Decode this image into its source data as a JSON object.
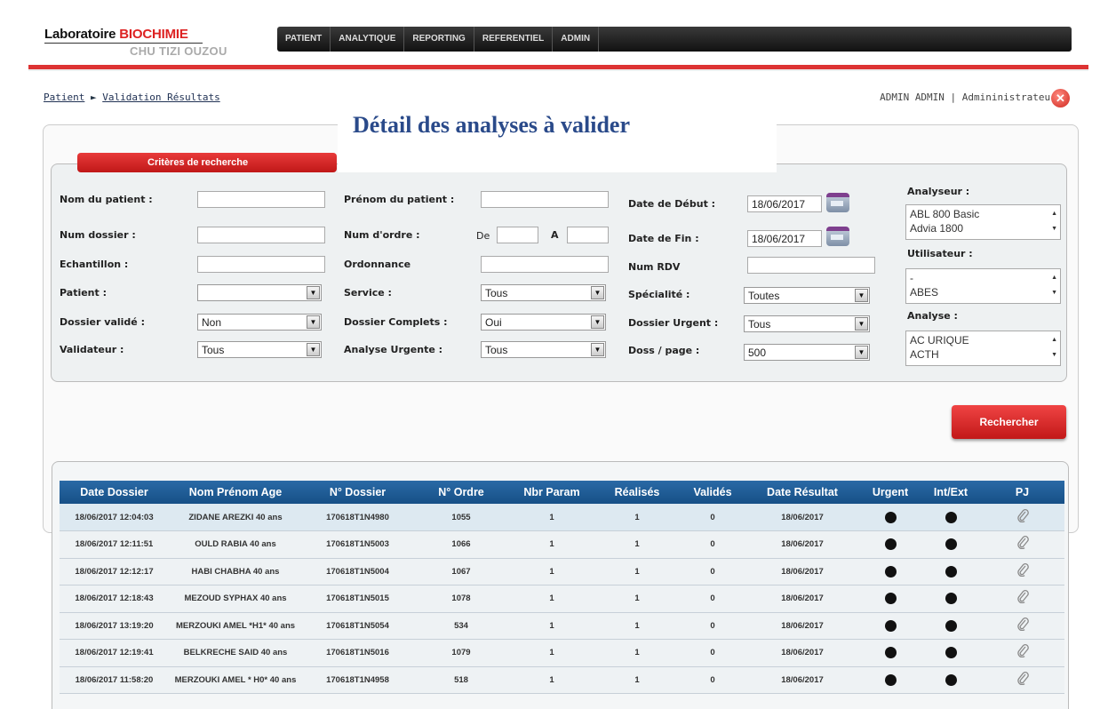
{
  "logo": {
    "line1_a": "Laboratoire ",
    "line1_b": "BIOCHIMIE",
    "line2": "CHU TIZI OUZOU",
    "accent": "#dd2222"
  },
  "nav": {
    "items": [
      "PATIENT",
      "ANALYTIQUE",
      "REPORTING",
      "REFERENTIEL",
      "ADMIN"
    ]
  },
  "breadcrumb": {
    "root": "Patient",
    "sep": "►",
    "current": "Validation Résultats"
  },
  "user": {
    "text": "ADMIN ADMIN | Admininistrateur |",
    "close_icon": "close-icon"
  },
  "title": "Détail des analyses à valider",
  "criteria_tab": "Critères de recherche",
  "form": {
    "nom_patient_label": "Nom du patient :",
    "num_dossier_label": "Num dossier :",
    "echantillon_label": "Echantillon :",
    "patient_label": "Patient :",
    "patient_value": "",
    "dossier_valide_label": "Dossier validé :",
    "dossier_valide_value": "Non",
    "validateur_label": "Validateur :",
    "validateur_value": "Tous",
    "prenom_label": "Prénom du patient :",
    "num_ordre_label": "Num d'ordre :",
    "de_label": "De",
    "a_label": "A",
    "ordonnance_label": "Ordonnance",
    "service_label": "Service :",
    "service_value": "Tous",
    "dossier_complets_label": "Dossier Complets :",
    "dossier_complets_value": "Oui",
    "analyse_urgente_label": "Analyse Urgente :",
    "analyse_urgente_value": "Tous",
    "date_debut_label": "Date de Début :",
    "date_debut_value": "18/06/2017",
    "date_fin_label": "Date de Fin :",
    "date_fin_value": "18/06/2017",
    "num_rdv_label": "Num RDV",
    "specialite_label": "Spécialité :",
    "specialite_value": "Toutes",
    "dossier_urgent_label": "Dossier Urgent :",
    "dossier_urgent_value": "Tous",
    "doss_page_label": "Doss / page :",
    "doss_page_value": "500",
    "analyseur_label": "Analyseur :",
    "analyseur_options": [
      "ABL 800 Basic",
      "Advia 1800"
    ],
    "utilisateur_label": "Utilisateur :",
    "utilisateur_options": [
      "-",
      "ABES"
    ],
    "analyse_label": "Analyse :",
    "analyse_options": [
      "AC URIQUE",
      "ACTH"
    ]
  },
  "search_button": "Rechercher",
  "table": {
    "headers": [
      "Date Dossier",
      "Nom Prénom Age",
      "N° Dossier",
      "N° Ordre",
      "Nbr Param",
      "Réalisés",
      "Validés",
      "Date Résultat",
      "Urgent",
      "Int/Ext",
      "PJ"
    ],
    "rows": [
      [
        "18/06/2017 12:04:03",
        "ZIDANE AREZKI 40 ans",
        "170618T1N4980",
        "1055",
        "1",
        "1",
        "0",
        "18/06/2017"
      ],
      [
        "18/06/2017 12:11:51",
        "OULD RABIA 40 ans",
        "170618T1N5003",
        "1066",
        "1",
        "1",
        "0",
        "18/06/2017"
      ],
      [
        "18/06/2017 12:12:17",
        "HABI CHABHA 40 ans",
        "170618T1N5004",
        "1067",
        "1",
        "1",
        "0",
        "18/06/2017"
      ],
      [
        "18/06/2017 12:18:43",
        "MEZOUD SYPHAX 40 ans",
        "170618T1N5015",
        "1078",
        "1",
        "1",
        "0",
        "18/06/2017"
      ],
      [
        "18/06/2017 13:19:20",
        "MERZOUKI AMEL *H1* 40 ans",
        "170618T1N5054",
        "534",
        "1",
        "1",
        "0",
        "18/06/2017"
      ],
      [
        "18/06/2017 12:19:41",
        "BELKRECHE SAID 40 ans",
        "170618T1N5016",
        "1079",
        "1",
        "1",
        "0",
        "18/06/2017"
      ],
      [
        "18/06/2017 11:58:20",
        "MERZOUKI AMEL * H0* 40 ans",
        "170618T1N4958",
        "518",
        "1",
        "1",
        "0",
        "18/06/2017"
      ]
    ]
  }
}
